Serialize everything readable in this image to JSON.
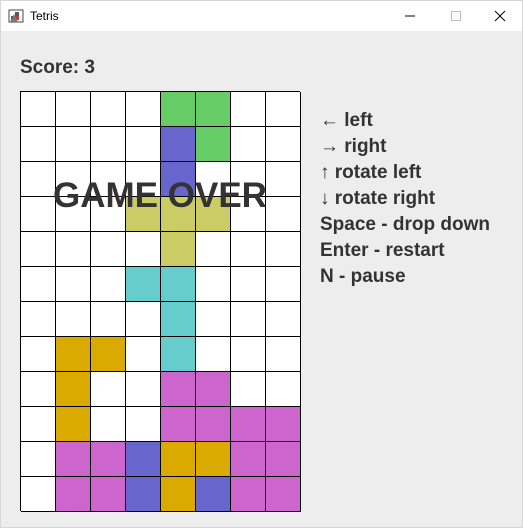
{
  "window": {
    "title": "Tetris",
    "icon": "tetris-app-icon",
    "controls": [
      "minimize-icon",
      "maximize-icon",
      "close-icon"
    ]
  },
  "game": {
    "score_text": "Score: 3",
    "status_text": "GAME OVER",
    "board": {
      "columns": 8,
      "rows": 12,
      "colors": {
        "green": "#66cc66",
        "blue": "#6666cc",
        "yellow": "#cccc66",
        "cyan": "#66cccc",
        "orange": "#daaa00",
        "purple": "#cc66cc",
        "empty": "#ffffff",
        "grid": "#000000"
      },
      "cells": [
        [
          "",
          "",
          "",
          "",
          "green",
          "green",
          "",
          ""
        ],
        [
          "",
          "",
          "",
          "",
          "blue",
          "green",
          "",
          ""
        ],
        [
          "",
          "",
          "",
          "",
          "blue",
          "",
          "",
          ""
        ],
        [
          "",
          "",
          "",
          "yellow",
          "yellow",
          "yellow",
          "",
          ""
        ],
        [
          "",
          "",
          "",
          "",
          "yellow",
          "",
          "",
          ""
        ],
        [
          "",
          "",
          "",
          "cyan",
          "cyan",
          "",
          "",
          ""
        ],
        [
          "",
          "",
          "",
          "",
          "cyan",
          "",
          "",
          ""
        ],
        [
          "",
          "orange",
          "orange",
          "",
          "cyan",
          "",
          "",
          ""
        ],
        [
          "",
          "orange",
          "",
          "",
          "purple",
          "purple",
          "",
          ""
        ],
        [
          "",
          "orange",
          "",
          "",
          "purple",
          "purple",
          "purple",
          "purple"
        ],
        [
          "",
          "purple",
          "purple",
          "blue",
          "orange",
          "orange",
          "purple",
          "purple"
        ],
        [
          "",
          "purple",
          "purple",
          "blue",
          "orange",
          "blue",
          "purple",
          "purple"
        ]
      ]
    }
  },
  "controls_help": [
    "← left",
    "→ right",
    "↑ rotate left",
    "↓ rotate right",
    "Space - drop down",
    "Enter - restart",
    "N - pause"
  ]
}
